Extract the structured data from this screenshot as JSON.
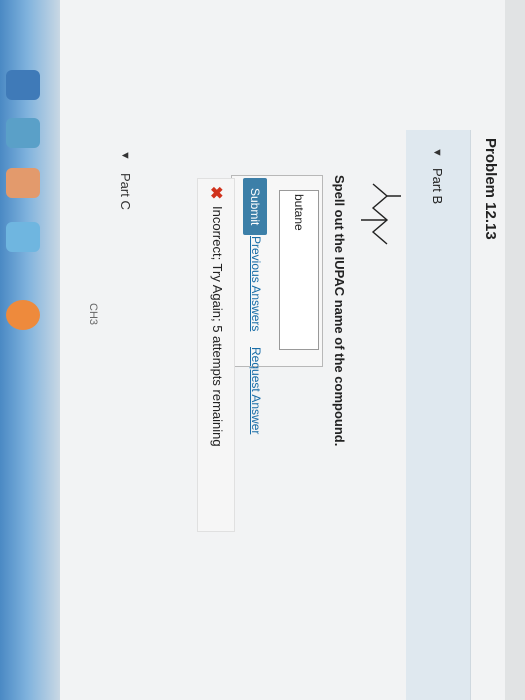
{
  "problem": {
    "title": "Problem 12.13"
  },
  "part_b": {
    "label": "Part B",
    "question": "Spell out the IUPAC name of the compound.",
    "answer_value": "butane",
    "submit_label": "Submit",
    "previous_answers_label": "Previous Answers",
    "request_answer_label": "Request Answer",
    "feedback": "Incorrect; Try Again; 5 attempts remaining"
  },
  "part_c": {
    "label": "Part C",
    "fragment_text": "CH3"
  },
  "colors": {
    "submit": "#3c7fa8",
    "link": "#1a6ea8",
    "error": "#d0321c",
    "part_bar": "#dfe8ef"
  }
}
